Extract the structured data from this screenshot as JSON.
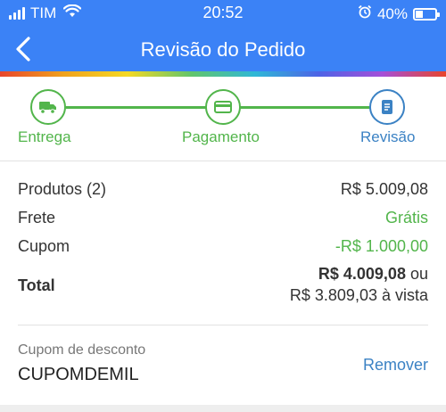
{
  "status_bar": {
    "carrier": "TIM",
    "time": "20:52",
    "battery_percent": "40%",
    "battery_level": 0.4
  },
  "header": {
    "title": "Revisão do Pedido",
    "background_color": "#3b82f6"
  },
  "stepper": {
    "steps": [
      {
        "label": "Entrega",
        "icon": "truck-icon",
        "state": "done"
      },
      {
        "label": "Pagamento",
        "icon": "credit-card-icon",
        "state": "done"
      },
      {
        "label": "Revisão",
        "icon": "document-icon",
        "state": "active"
      }
    ],
    "done_color": "#52b54b",
    "active_color": "#3b82c4"
  },
  "summary": {
    "products_label": "Produtos (2)",
    "products_value": "R$ 5.009,08",
    "shipping_label": "Frete",
    "shipping_value": "Grátis",
    "coupon_label": "Cupom",
    "coupon_value": "-R$ 1.000,00",
    "total_label": "Total",
    "total_value": "R$ 4.009,08",
    "total_or": "ou",
    "total_cash": "R$ 3.809,03 à vista"
  },
  "coupon": {
    "label": "Cupom de desconto",
    "code": "CUPOMDEMIL",
    "remove_label": "Remover"
  }
}
